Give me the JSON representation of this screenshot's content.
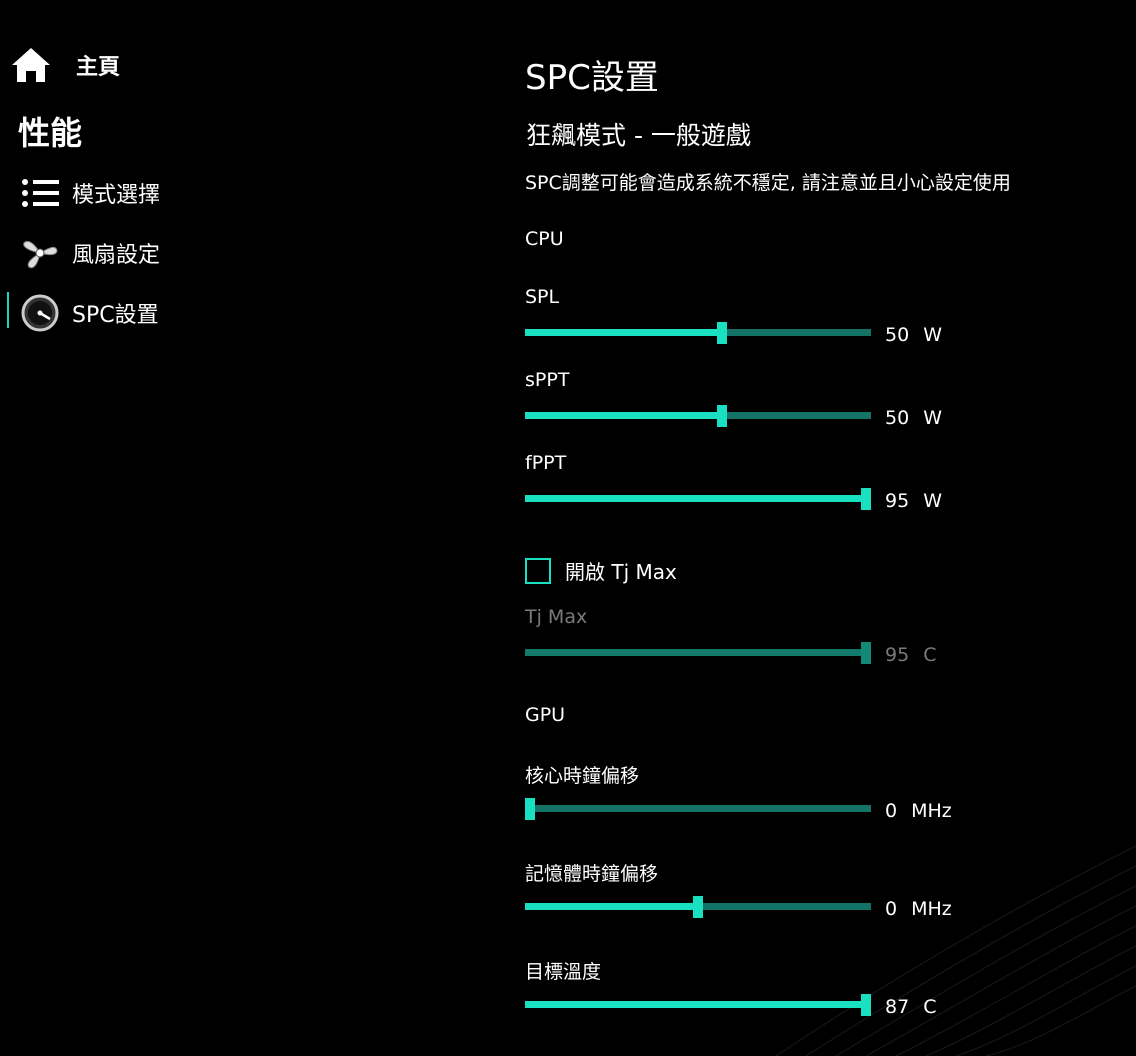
{
  "sidebar": {
    "home_label": "主頁",
    "section_title": "性能",
    "items": [
      {
        "label": "模式選擇"
      },
      {
        "label": "風扇設定"
      },
      {
        "label": "SPC設置"
      }
    ]
  },
  "main": {
    "title": "SPC設置",
    "mode_title": "狂飆模式 - 一般遊戲",
    "warning": "SPC調整可能會造成系統不穩定, 請注意並且小心設定使用",
    "cpu": {
      "title": "CPU",
      "spl": {
        "label": "SPL",
        "value": "50",
        "unit": "W",
        "fraction": 0.57
      },
      "sppt": {
        "label": "sPPT",
        "value": "50",
        "unit": "W",
        "fraction": 0.57
      },
      "fppt": {
        "label": "fPPT",
        "value": "95",
        "unit": "W",
        "fraction": 1.0
      },
      "tjmax_toggle_label": "開啟 Tj Max",
      "tjmax": {
        "label": "Tj Max",
        "value": "95",
        "unit": "C",
        "fraction": 1.0
      }
    },
    "gpu": {
      "title": "GPU",
      "core_offset": {
        "label": "核心時鐘偏移",
        "value": "0",
        "unit": "MHz",
        "fraction": 0.0
      },
      "mem_offset": {
        "label": "記憶體時鐘偏移",
        "value": "0",
        "unit": "MHz",
        "fraction": 0.5
      },
      "target_temp": {
        "label": "目標溫度",
        "value": "87",
        "unit": "C",
        "fraction": 1.0
      }
    }
  },
  "colors": {
    "accent": "#19e0c0",
    "track": "#137366",
    "background": "#000000"
  }
}
